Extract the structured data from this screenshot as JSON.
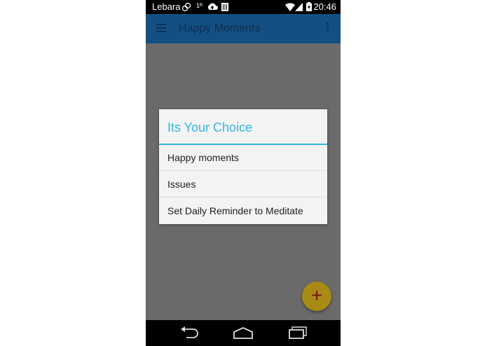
{
  "status_bar": {
    "carrier": "Lebara",
    "roaming": "1ᴿ",
    "time": "20:46",
    "icons": [
      "link-icon",
      "cloud-upload-icon",
      "storage-icon",
      "wifi-icon",
      "signal-icon",
      "battery-icon"
    ]
  },
  "app_bar": {
    "title": "Happy Moments",
    "background": "#134f83"
  },
  "dialog": {
    "title": "Its Your Choice",
    "accent": "#33b5e5",
    "options": [
      {
        "label": "Happy moments"
      },
      {
        "label": "Issues"
      },
      {
        "label": "Set Daily Reminder to Meditate"
      }
    ]
  },
  "fab": {
    "label": "+",
    "color": "#a88a14"
  },
  "nav_bar": {
    "buttons": [
      "back-icon",
      "home-icon",
      "recents-icon"
    ]
  }
}
